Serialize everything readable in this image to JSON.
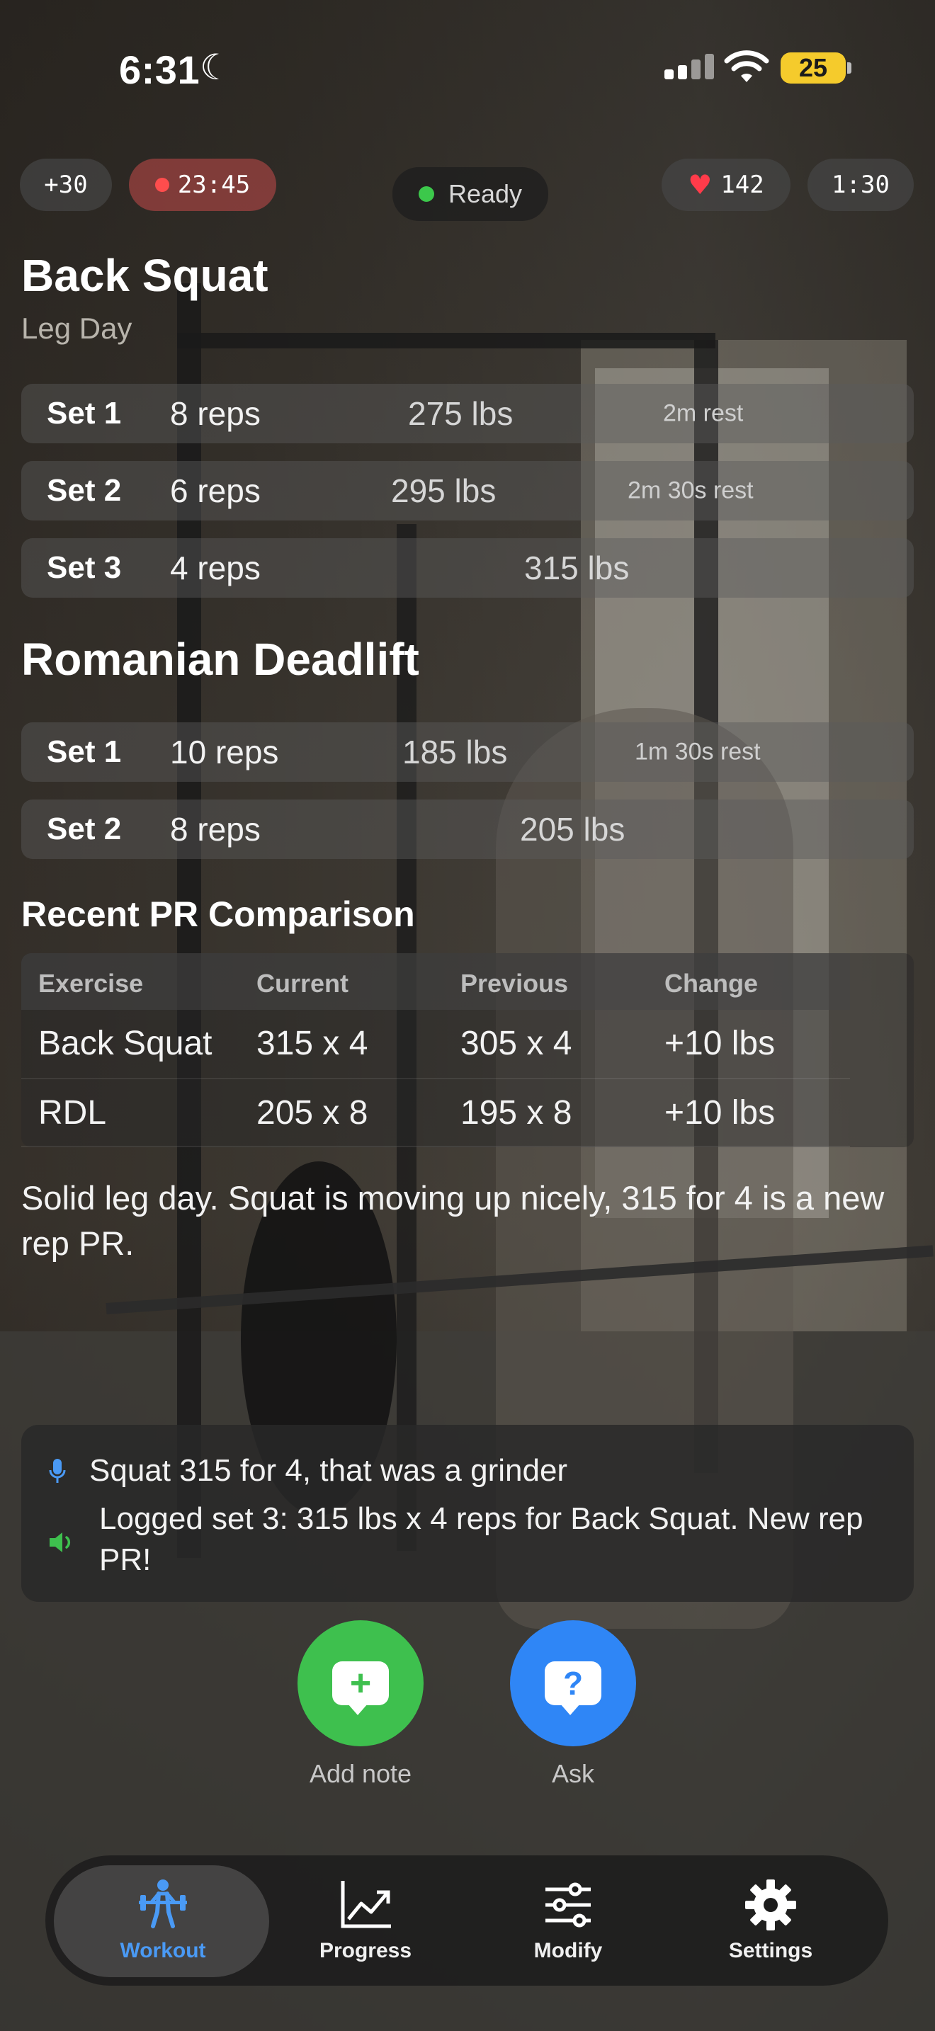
{
  "status": {
    "time": "6:31",
    "battery": "25"
  },
  "header": {
    "extra_time": "+30",
    "recording_timer": "23:45",
    "status": "Ready",
    "heart_rate": "142",
    "rest_timer": "1:30"
  },
  "exercises": [
    {
      "name": "Back Squat",
      "subtitle": "Leg Day",
      "sets": [
        {
          "label": "Set 1",
          "reps": "8 reps",
          "weight": "275 lbs",
          "rest": "2m rest"
        },
        {
          "label": "Set 2",
          "reps": "6 reps",
          "weight": "295 lbs",
          "rest": "2m 30s rest"
        },
        {
          "label": "Set 3",
          "reps": "4 reps",
          "weight": "315 lbs",
          "rest": ""
        }
      ]
    },
    {
      "name": "Romanian Deadlift",
      "sets": [
        {
          "label": "Set 1",
          "reps": "10 reps",
          "weight": "185 lbs",
          "rest": "1m 30s rest"
        },
        {
          "label": "Set 2",
          "reps": "8 reps",
          "weight": "205 lbs",
          "rest": ""
        }
      ]
    }
  ],
  "pr_comparison": {
    "title": "Recent PR Comparison",
    "columns": [
      "Exercise",
      "Current",
      "Previous",
      "Change"
    ],
    "rows": [
      [
        "Back Squat",
        "315 x 4",
        "305 x 4",
        "+10 lbs"
      ],
      [
        "RDL",
        "205 x 8",
        "195 x 8",
        "+10 lbs"
      ]
    ]
  },
  "summary": "Solid leg day. Squat is moving up nicely, 315 for 4 is a new rep PR.",
  "transcript": {
    "user": "Squat 315 for 4, that was a grinder",
    "assistant": "Logged set 3: 315 lbs x 4 reps for Back Squat. New rep PR!"
  },
  "actions": {
    "add_note": "Add note",
    "ask": "Ask"
  },
  "tabs": [
    {
      "label": "Workout",
      "icon": "workout-icon",
      "active": true
    },
    {
      "label": "Progress",
      "icon": "progress-chart-icon",
      "active": false
    },
    {
      "label": "Modify",
      "icon": "sliders-icon",
      "active": false
    },
    {
      "label": "Settings",
      "icon": "gear-icon",
      "active": false
    }
  ],
  "colors": {
    "accent_green": "#3ec04e",
    "accent_blue": "#2f86f6",
    "active_tab": "#4a9af5",
    "recording_red": "#ff4d4d",
    "battery_yellow": "#f5cb2c"
  }
}
